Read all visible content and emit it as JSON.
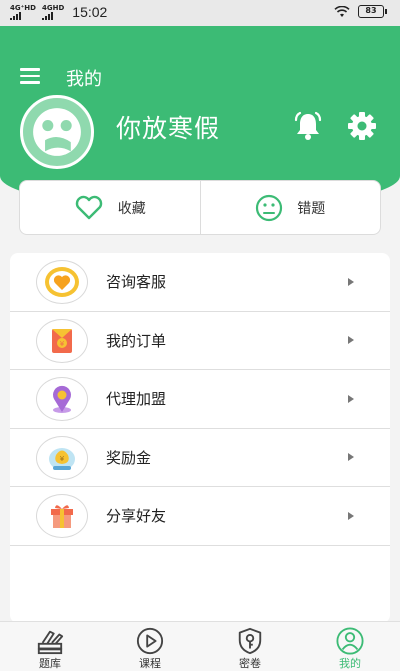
{
  "status_bar": {
    "signal_1": "4G⁺HD",
    "signal_2": "4GHD",
    "time": "15:02",
    "battery": "83"
  },
  "header": {
    "title": "我的",
    "username": "你放寒假"
  },
  "quick_actions": {
    "favorites_label": "收藏",
    "wrong_questions_label": "错题"
  },
  "menu": [
    {
      "label": "咨询客服",
      "icon": "heart-badge-icon"
    },
    {
      "label": "我的订单",
      "icon": "red-envelope-icon"
    },
    {
      "label": "代理加盟",
      "icon": "location-pin-icon"
    },
    {
      "label": "奖励金",
      "icon": "money-bag-icon"
    },
    {
      "label": "分享好友",
      "icon": "gift-box-icon"
    }
  ],
  "tabs": [
    {
      "label": "题库",
      "icon": "books-icon",
      "active": false
    },
    {
      "label": "课程",
      "icon": "play-circle-icon",
      "active": false
    },
    {
      "label": "密卷",
      "icon": "key-shield-icon",
      "active": false
    },
    {
      "label": "我的",
      "icon": "user-circle-icon",
      "active": true
    }
  ],
  "colors": {
    "brand_green": "#3cbb75",
    "background": "#f3f3f3"
  }
}
